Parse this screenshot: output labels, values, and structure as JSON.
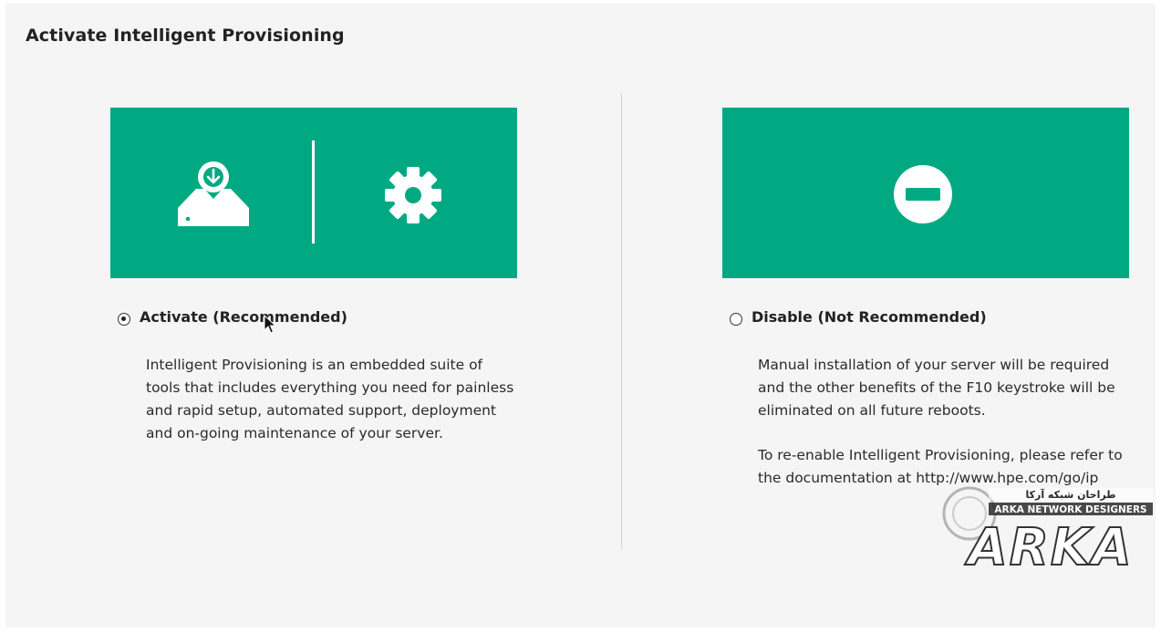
{
  "page": {
    "title": "Activate Intelligent Provisioning"
  },
  "options": {
    "activate": {
      "label": "Activate (Recommended)",
      "selected": true,
      "description": "Intelligent Provisioning is an embedded suite of tools that includes everything you need for painless and rapid setup, automated support, deployment and on-going maintenance of your server.",
      "icons": [
        "download-drive-icon",
        "gear-icon"
      ]
    },
    "disable": {
      "label": "Disable (Not Recommended)",
      "selected": false,
      "description": "Manual installation of your server will be required and the other benefits of the F10 keystroke will be eliminated on all future reboots.",
      "reenable_note_prefix": "To re-enable Intelligent Provisioning, please refer to the documentation at",
      "reenable_link": "http://www.hpe.com/go/ip",
      "icons": [
        "disable-icon"
      ]
    }
  },
  "watermark": {
    "brand": "ARKA",
    "subtitle": "ARKA NETWORK DESIGNERS",
    "native_text": "طراحان شبکه آرکا"
  },
  "colors": {
    "banner": "#01a982",
    "background": "#f5f5f5",
    "text": "#222222",
    "icon": "#ffffff"
  }
}
